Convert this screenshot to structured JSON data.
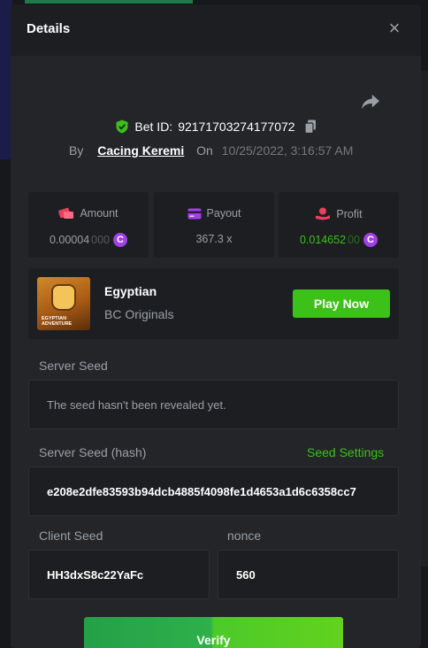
{
  "modal": {
    "title": "Details",
    "close_symbol": "×"
  },
  "bet": {
    "id_label": "Bet ID:",
    "id_value": "92171703274177072",
    "by_label": "By",
    "user": "Cacing Keremi",
    "on_label": "On",
    "date": "10/25/2022, 3:16:57 AM"
  },
  "stats": {
    "amount": {
      "label": "Amount",
      "value_main": "0.00004",
      "value_dim": "000"
    },
    "payout": {
      "label": "Payout",
      "value": "367.3 x"
    },
    "profit": {
      "label": "Profit",
      "value_main": "0.014652",
      "value_dim": "00"
    },
    "coin_symbol": "C"
  },
  "game": {
    "thumb_text": "EGYPTIAN ADVENTURE",
    "name": "Egyptian",
    "provider": "BC Originals",
    "play_label": "Play Now"
  },
  "server_seed": {
    "label": "Server Seed",
    "value": "The seed hasn't been revealed yet."
  },
  "server_seed_hash": {
    "label": "Server Seed (hash)",
    "settings_label": "Seed Settings",
    "value": "e208e2dfe83593b94dcb4885f4098fe1d4653a1d6c6358cc7"
  },
  "client_seed": {
    "label": "Client Seed",
    "value": "HH3dxS8c22YaFc"
  },
  "nonce": {
    "label": "nonce",
    "value": "560"
  },
  "verify": {
    "label": "Verify"
  },
  "colors": {
    "accent_green": "#3bc117",
    "coin_purple": "#a240e8",
    "panel": "#232529",
    "card": "#1c1e22"
  }
}
